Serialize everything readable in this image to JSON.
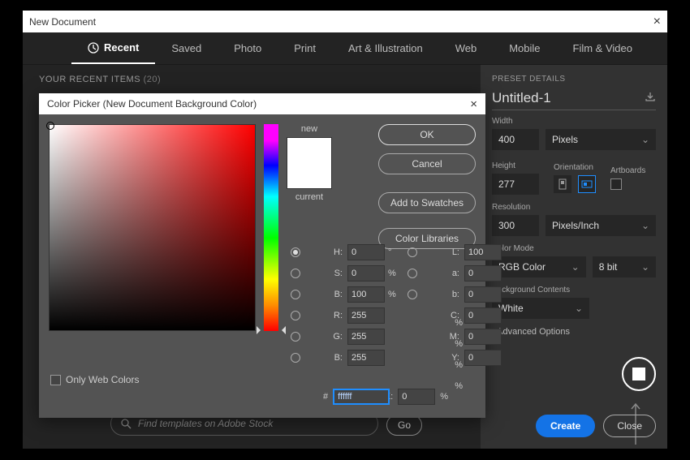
{
  "window": {
    "title": "New Document",
    "close": "×"
  },
  "tabs": [
    "Recent",
    "Saved",
    "Photo",
    "Print",
    "Art & Illustration",
    "Web",
    "Mobile",
    "Film & Video"
  ],
  "recent": {
    "label": "YOUR RECENT ITEMS",
    "count": "(20)"
  },
  "search": {
    "placeholder": "Find templates on Adobe Stock",
    "go": "Go"
  },
  "preset": {
    "header": "PRESET DETAILS",
    "name": "Untitled-1",
    "width_label": "Width",
    "width": "400",
    "unit": "Pixels",
    "height_label": "Height",
    "height": "277",
    "orient_label": "Orientation",
    "art_label": "Artboards",
    "res_label": "Resolution",
    "res": "300",
    "res_unit": "Pixels/Inch",
    "mode_label": "Color Mode",
    "mode": "RGB Color",
    "depth": "8 bit",
    "bg_label": "Background Contents",
    "bg": "White",
    "advanced": "Advanced Options",
    "create": "Create",
    "close": "Close"
  },
  "picker": {
    "title": "Color Picker (New Document Background Color)",
    "close": "×",
    "new": "new",
    "current": "current",
    "ok": "OK",
    "cancel": "Cancel",
    "swatches": "Add to Swatches",
    "libs": "Color Libraries",
    "hsb": {
      "H": "0",
      "S": "0",
      "B": "100"
    },
    "lab": {
      "L": "100",
      "a": "0",
      "b": "0"
    },
    "rgb": {
      "R": "255",
      "G": "255",
      "B": "255"
    },
    "cmyk": {
      "C": "0",
      "M": "0",
      "Y": "0",
      "K": "0"
    },
    "deg": "°",
    "pct": "%",
    "hash": "#",
    "hex": "ffffff",
    "owc": "Only Web Colors"
  }
}
